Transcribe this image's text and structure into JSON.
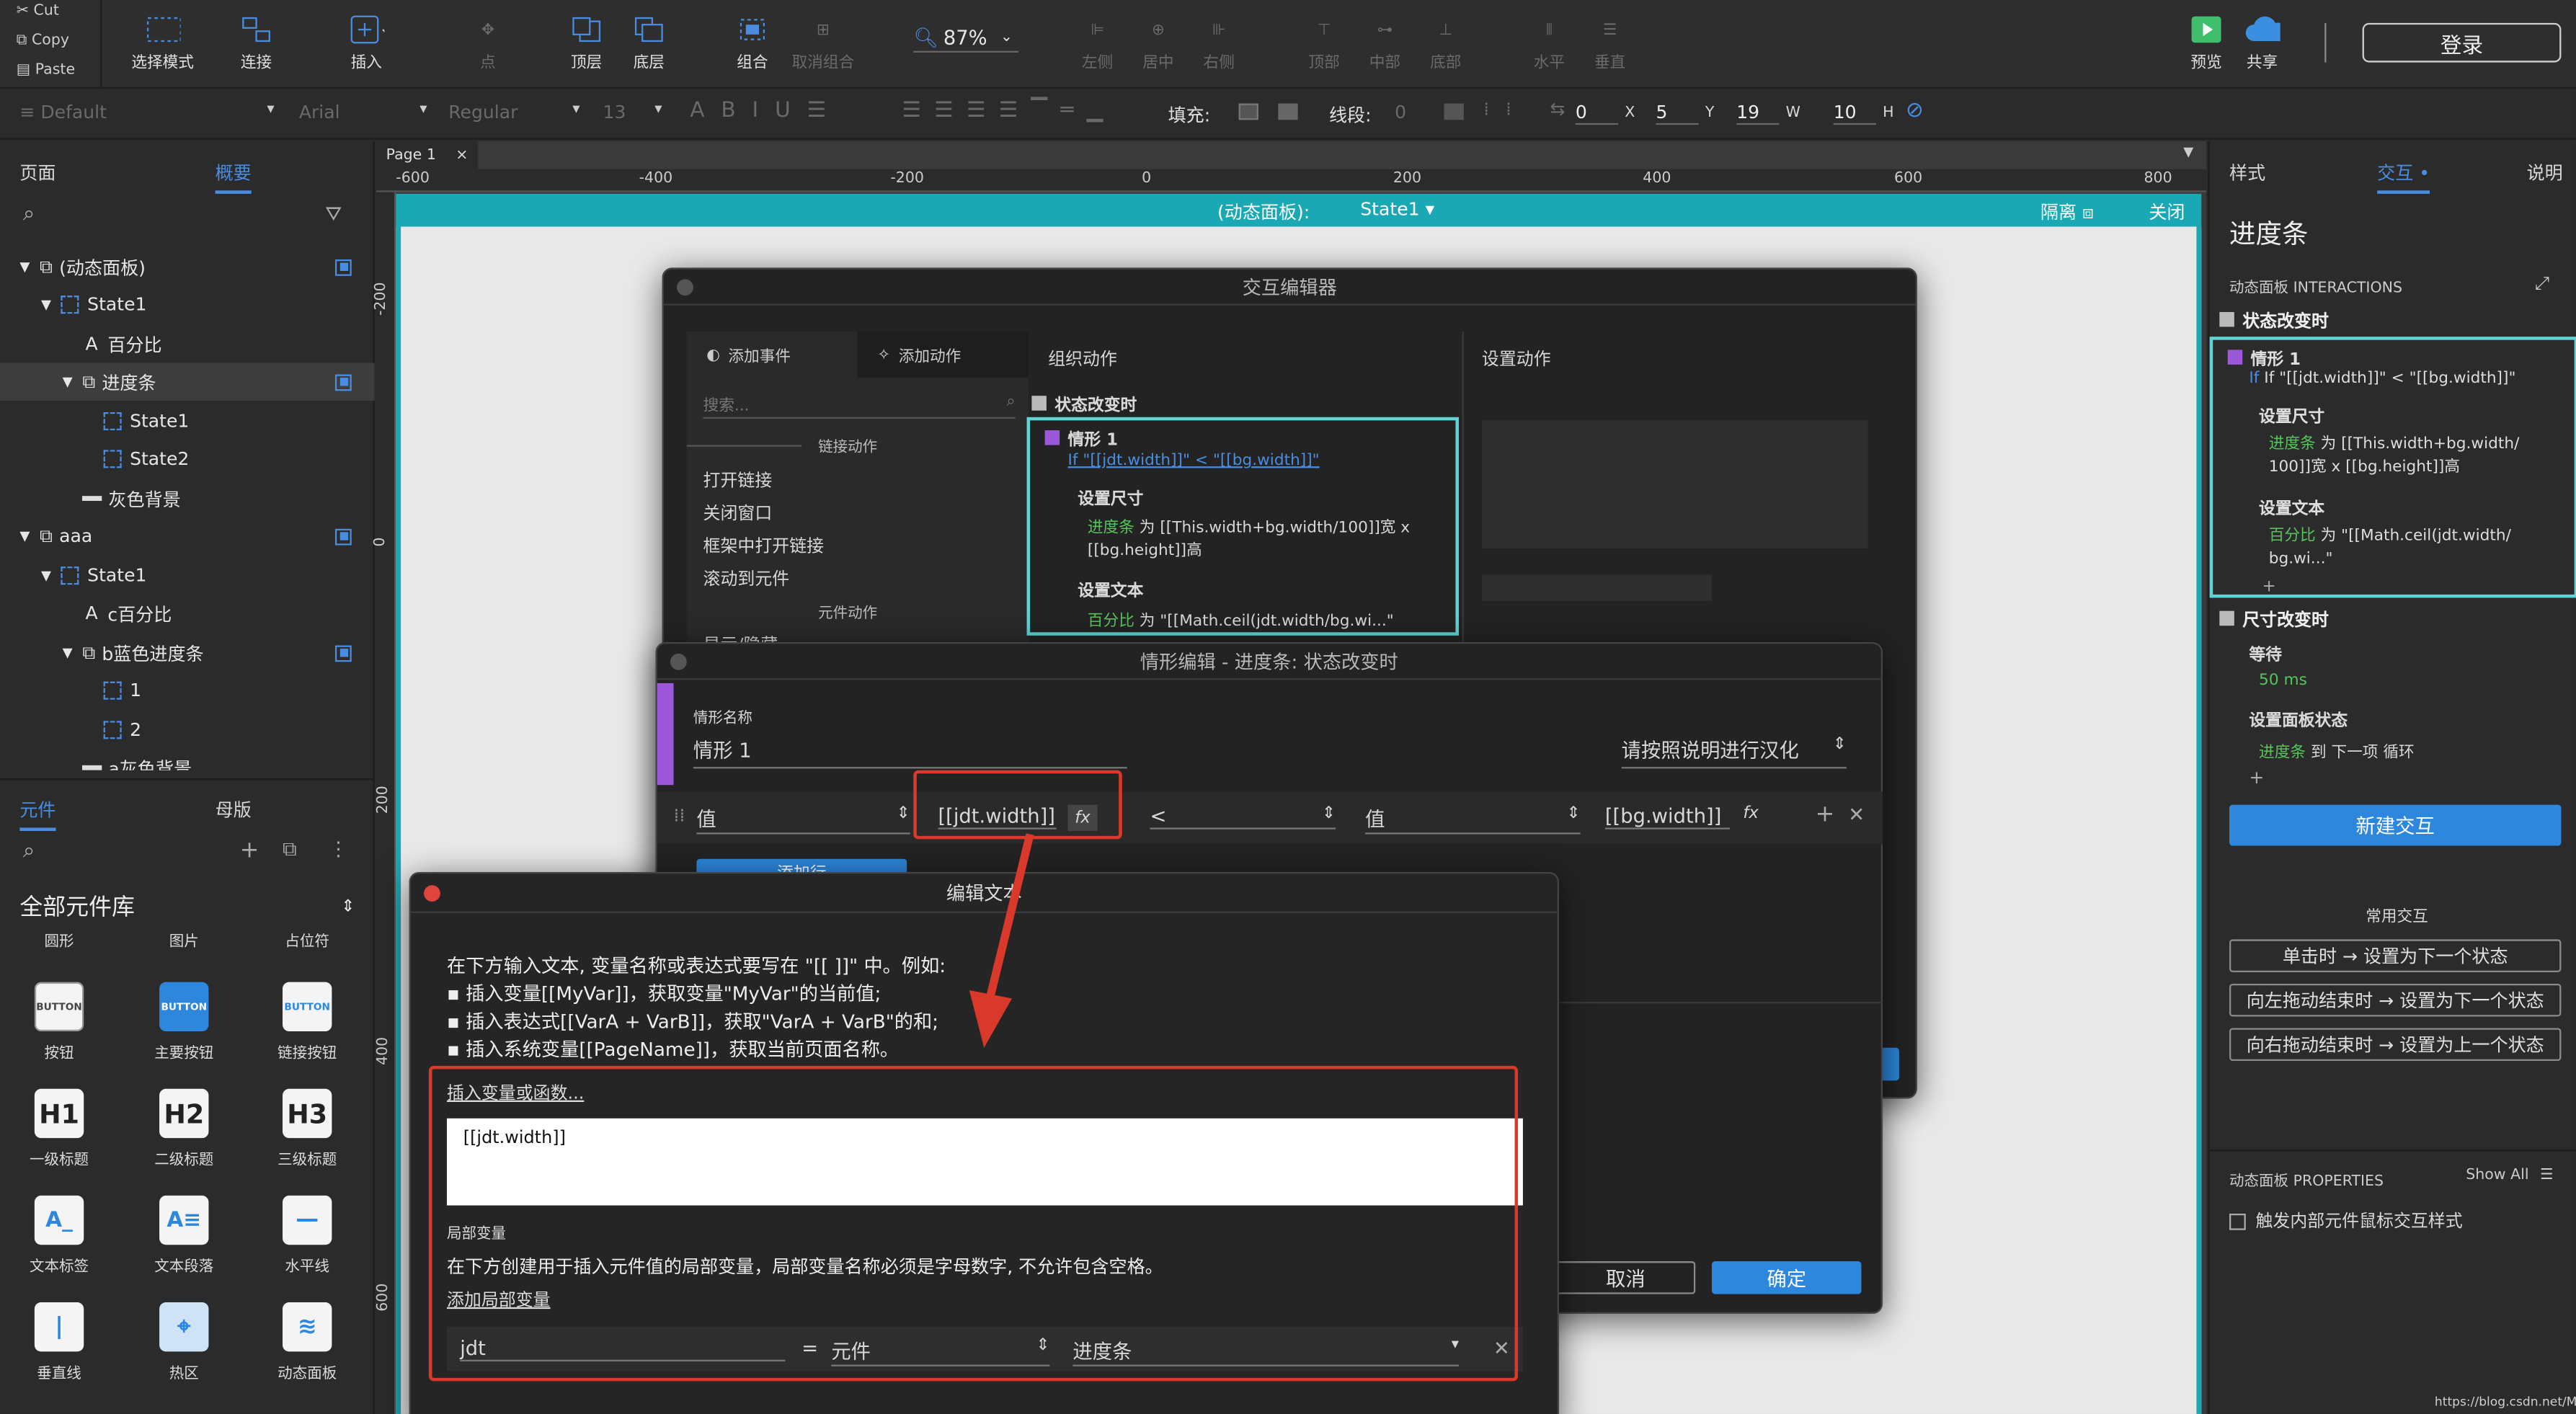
{
  "clipboard": {
    "cut": "Cut",
    "copy": "Copy",
    "paste": "Paste"
  },
  "toolbar": {
    "select_mode": "选择模式",
    "connect": "连接",
    "insert": "插入",
    "point": "点",
    "top": "顶层",
    "bottom": "底层",
    "group": "组合",
    "ungroup": "取消组合",
    "zoom": "87%",
    "left": "左侧",
    "center": "居中",
    "right": "右侧",
    "top_align": "顶部",
    "middle": "中部",
    "bottom_align": "底部",
    "horizontal": "水平",
    "vertical": "垂直",
    "preview": "预览",
    "share": "共享",
    "login": "登录"
  },
  "format": {
    "style": "Default",
    "font": "Arial",
    "weight": "Regular",
    "size": "13",
    "fill_label": "填充:",
    "stroke_label": "线段:",
    "stroke_val": "0",
    "x": "0",
    "x_label": "X",
    "y": "5",
    "y_label": "Y",
    "w": "19",
    "w_label": "W",
    "h": "10",
    "h_label": "H"
  },
  "left_tabs": {
    "pages": "页面",
    "outline": "概要"
  },
  "outline": [
    {
      "label": "(动态面板)",
      "icon": "layers"
    },
    {
      "label": "State1",
      "icon": "state"
    },
    {
      "label": "百分比",
      "icon": "text"
    },
    {
      "label": "进度条",
      "icon": "layers"
    },
    {
      "label": "State1",
      "icon": "state"
    },
    {
      "label": "State2",
      "icon": "state"
    },
    {
      "label": "灰色背景",
      "icon": "line"
    },
    {
      "label": "aaa",
      "icon": "layers"
    },
    {
      "label": "State1",
      "icon": "state"
    },
    {
      "label": "c百分比",
      "icon": "text"
    },
    {
      "label": "b蓝色进度条",
      "icon": "layers"
    },
    {
      "label": "1",
      "icon": "state"
    },
    {
      "label": "2",
      "icon": "state"
    },
    {
      "label": "a灰色背景",
      "icon": "line"
    }
  ],
  "lib_tabs": {
    "widgets": "元件",
    "masters": "母版"
  },
  "library": {
    "name": "全部元件库",
    "top_row": [
      "圆形",
      "图片",
      "占位符"
    ],
    "items": [
      {
        "label": "按钮",
        "icon": "BUTTON"
      },
      {
        "label": "主要按钮",
        "icon": "BUTTON"
      },
      {
        "label": "链接按钮",
        "icon": "BUTTON"
      },
      {
        "label": "一级标题",
        "icon": "H1"
      },
      {
        "label": "二级标题",
        "icon": "H2"
      },
      {
        "label": "三级标题",
        "icon": "H3"
      },
      {
        "label": "文本标签",
        "icon": "A_"
      },
      {
        "label": "文本段落",
        "icon": "A≡"
      },
      {
        "label": "水平线",
        "icon": "—"
      },
      {
        "label": "垂直线",
        "icon": "|"
      },
      {
        "label": "热区",
        "icon": "⌖"
      },
      {
        "label": "动态面板",
        "icon": "≋"
      }
    ]
  },
  "canvas": {
    "page_tab": "Page 1",
    "ruler_h": [
      "-600",
      "-400",
      "-200",
      "0",
      "200",
      "400",
      "600",
      "800"
    ],
    "ruler_v": [
      "-200",
      "0",
      "200",
      "400",
      "600"
    ],
    "panel_label": "(动态面板):",
    "state": "State1",
    "isolate": "隔离",
    "close": "关闭"
  },
  "interaction_editor": {
    "title": "交互编辑器",
    "add_event": "添加事件",
    "add_action": "添加动作",
    "search": "搜索...",
    "link_actions": "链接动作",
    "actions": [
      "打开链接",
      "关闭窗口",
      "框架中打开链接",
      "滚动到元件"
    ],
    "widget_actions": "元件动作",
    "show_hide": "显示/隐藏",
    "organize": "组织动作",
    "event": "状态改变时",
    "case": "情形 1",
    "condition": "If \"[[jdt.width]]\" < \"[[bg.width]]\"",
    "set_size": "设置尺寸",
    "size_target": "进度条",
    "size_text": "为 [[This.width+bg.width/100]]宽 x [[bg.height]]高",
    "set_text": "设置文本",
    "text_target": "百分比",
    "text_text": "为 \"[[Math.ceil(jdt.width/bg.wi...\"",
    "config": "设置动作"
  },
  "case_editor": {
    "title": "情形编辑  -  进度条: 状态改变时",
    "case_name_label": "情形名称",
    "case_name": "情形 1",
    "hint": "请按照说明进行汉化",
    "cond_left_type": "值",
    "cond_left_val": "[[jdt.width]]",
    "operator": "<",
    "cond_right_type": "值",
    "cond_right_val": "[[bg.width]]",
    "fx": "fx",
    "add_row": "添加行",
    "cancel": "取消",
    "ok": "确定"
  },
  "edit_text": {
    "title": "编辑文本",
    "intro": "在下方输入文本, 变量名称或表达式要写在 \"[[ ]]\" 中。例如:",
    "bullets": [
      "▪ 插入变量[[MyVar]]，获取变量\"MyVar\"的当前值;",
      "▪ 插入表达式[[VarA + VarB]]，获取\"VarA + VarB\"的和;",
      "▪ 插入系统变量[[PageName]]，获取当前页面名称。"
    ],
    "insert_link": "插入变量或函数...",
    "text_value": "[[jdt.width]]",
    "local_vars": "局部变量",
    "local_desc": "在下方创建用于插入元件值的局部变量，局部变量名称必须是字母数字, 不允许包含空格。",
    "add_local": "添加局部变量",
    "var_name": "jdt",
    "equals": "=",
    "var_type": "元件",
    "var_target": "进度条"
  },
  "right": {
    "tabs": [
      "样式",
      "交互",
      "说明"
    ],
    "title": "进度条",
    "interactions_label": "动态面板 INTERACTIONS",
    "event1": "状态改变时",
    "case": "情形 1",
    "condition": "If \"[[jdt.width]]\" < \"[[bg.width]]\"",
    "set_size": "设置尺寸",
    "size_target": "进度条",
    "size_text": "为 [[This.width+bg.width/ 100]]宽 x [[bg.height]]高",
    "set_text": "设置文本",
    "text_target": "百分比",
    "text_text": "为 \"[[Math.ceil(jdt.width/ bg.wi...\"",
    "event2": "尺寸改变时",
    "wait": "等待",
    "wait_ms": "50 ms",
    "set_state": "设置面板状态",
    "state_target": "进度条",
    "state_text": "到 下一项 循环",
    "new_interaction": "新建交互",
    "common": "常用交互",
    "common_items": [
      "单击时 → 设置为下一个状态",
      "向左拖动结束时 → 设置为下一个状态",
      "向右拖动结束时 → 设置为上一个状态"
    ],
    "properties": "动态面板 PROPERTIES",
    "show_all": "Show All",
    "trigger": "触发内部元件鼠标交互样式"
  },
  "watermark": "https://blog.csdn.net/M_try",
  "colors": {
    "accent": "#2d87dc",
    "cyan": "#5fd3d5",
    "green": "#58c35c",
    "red": "#d9392b",
    "purple": "#9b59d9"
  }
}
